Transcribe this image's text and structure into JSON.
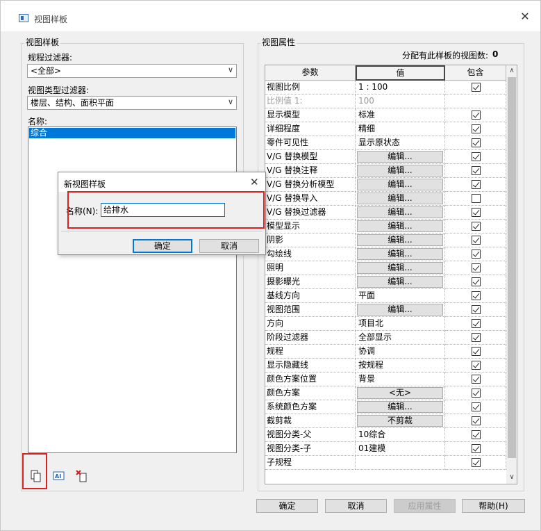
{
  "window": {
    "title": "视图样板"
  },
  "left_panel": {
    "legend": "视图样板",
    "discipline_filter_label": "规程过滤器:",
    "discipline_filter_value": "<全部>",
    "viewtype_filter_label": "视图类型过滤器:",
    "viewtype_filter_value": "楼层、结构、面积平面",
    "names_label": "名称:",
    "names": [
      "综合"
    ]
  },
  "right_panel": {
    "legend": "视图属性",
    "assigned_label": "分配有此样板的视图数:",
    "assigned_count": "0",
    "columns": {
      "param": "参数",
      "value": "值",
      "include": "包含"
    },
    "rows": [
      {
        "param": "视图比例",
        "value": "1 : 100",
        "type": "text",
        "include": true
      },
      {
        "param": "比例值 1:",
        "value": "100",
        "type": "grey",
        "include": null
      },
      {
        "param": "显示模型",
        "value": "标准",
        "type": "text",
        "include": true
      },
      {
        "param": "详细程度",
        "value": "精细",
        "type": "text",
        "include": true
      },
      {
        "param": "零件可见性",
        "value": "显示原状态",
        "type": "text",
        "include": true
      },
      {
        "param": "V/G 替换模型",
        "value": "编辑...",
        "type": "button",
        "include": true
      },
      {
        "param": "V/G 替换注释",
        "value": "编辑...",
        "type": "button",
        "include": true
      },
      {
        "param": "V/G 替换分析模型",
        "value": "编辑...",
        "type": "button",
        "include": true
      },
      {
        "param": "V/G 替换导入",
        "value": "编辑...",
        "type": "button",
        "include": false
      },
      {
        "param": "V/G 替换过滤器",
        "value": "编辑...",
        "type": "button",
        "include": true
      },
      {
        "param": "模型显示",
        "value": "编辑...",
        "type": "button",
        "include": true
      },
      {
        "param": "阴影",
        "value": "编辑...",
        "type": "button",
        "include": true
      },
      {
        "param": "勾绘线",
        "value": "编辑...",
        "type": "button",
        "include": true
      },
      {
        "param": "照明",
        "value": "编辑...",
        "type": "button",
        "include": true
      },
      {
        "param": "摄影曝光",
        "value": "编辑...",
        "type": "button",
        "include": true
      },
      {
        "param": "基线方向",
        "value": "平面",
        "type": "text",
        "include": true
      },
      {
        "param": "视图范围",
        "value": "编辑...",
        "type": "button",
        "include": true
      },
      {
        "param": "方向",
        "value": "项目北",
        "type": "text",
        "include": true
      },
      {
        "param": "阶段过滤器",
        "value": "全部显示",
        "type": "text",
        "include": true
      },
      {
        "param": "规程",
        "value": "协调",
        "type": "text",
        "include": true
      },
      {
        "param": "显示隐藏线",
        "value": "按规程",
        "type": "text",
        "include": true
      },
      {
        "param": "颜色方案位置",
        "value": "背景",
        "type": "text",
        "include": true
      },
      {
        "param": "颜色方案",
        "value": "<无>",
        "type": "button",
        "include": true
      },
      {
        "param": "系统颜色方案",
        "value": "编辑...",
        "type": "button",
        "include": true
      },
      {
        "param": "截剪裁",
        "value": "不剪裁",
        "type": "button",
        "include": true
      },
      {
        "param": "视图分类-父",
        "value": "10综合",
        "type": "text",
        "include": true
      },
      {
        "param": "视图分类-子",
        "value": "01建模",
        "type": "text",
        "include": true
      },
      {
        "param": "子规程",
        "value": "",
        "type": "text",
        "include": true
      }
    ]
  },
  "footer": {
    "ok": "确定",
    "cancel": "取消",
    "apply": "应用属性",
    "help": "帮助(H)"
  },
  "sub_dialog": {
    "title": "新视图样板",
    "name_label": "名称(N):",
    "name_value": "给排水",
    "ok": "确定",
    "cancel": "取消"
  },
  "icons": {
    "duplicate": "duplicate-icon",
    "rename": "rename-icon",
    "delete": "delete-icon"
  },
  "colors": {
    "selection": "#0078d7",
    "highlight_box": "#e02020"
  }
}
